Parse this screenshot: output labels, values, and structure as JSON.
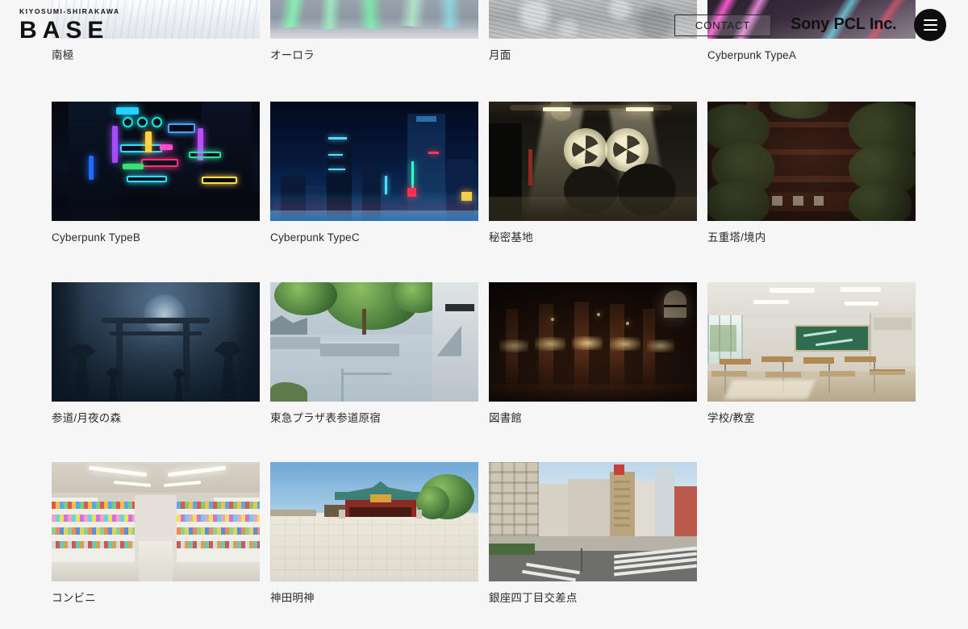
{
  "site": {
    "logo_sub": "KIYOSUMI-SHIRAKAWA",
    "logo_main": "BASE",
    "brand": "Sony PCL Inc.",
    "contact_label": "CONTACT",
    "menu_icon": "hamburger-menu-icon",
    "background_color": "#f6f6f6",
    "accent_color": "#0d0d0d"
  },
  "gallery": {
    "rows": [
      {
        "partial": true,
        "items": [
          {
            "caption": "南極",
            "art": "antarctic"
          },
          {
            "caption": "オーロラ",
            "art": "aurora"
          },
          {
            "caption": "月面",
            "art": "moon"
          },
          {
            "caption": "Cyberpunk TypeA",
            "art": "cpa"
          }
        ]
      },
      {
        "partial": false,
        "items": [
          {
            "caption": "Cyberpunk TypeB",
            "art": "cpb"
          },
          {
            "caption": "Cyberpunk TypeC",
            "art": "cpc"
          },
          {
            "caption": "秘密基地",
            "art": "base"
          },
          {
            "caption": "五重塔/境内",
            "art": "pagoda"
          }
        ]
      },
      {
        "partial": false,
        "items": [
          {
            "caption": "参道/月夜の森",
            "art": "torii"
          },
          {
            "caption": "東急プラザ表参道原宿",
            "art": "plaza"
          },
          {
            "caption": "図書館",
            "art": "library"
          },
          {
            "caption": "学校/教室",
            "art": "class"
          }
        ]
      },
      {
        "partial": false,
        "items": [
          {
            "caption": "コンビニ",
            "art": "store"
          },
          {
            "caption": "神田明神",
            "art": "shrine"
          },
          {
            "caption": "銀座四丁目交差点",
            "art": "ginza"
          }
        ]
      }
    ]
  }
}
